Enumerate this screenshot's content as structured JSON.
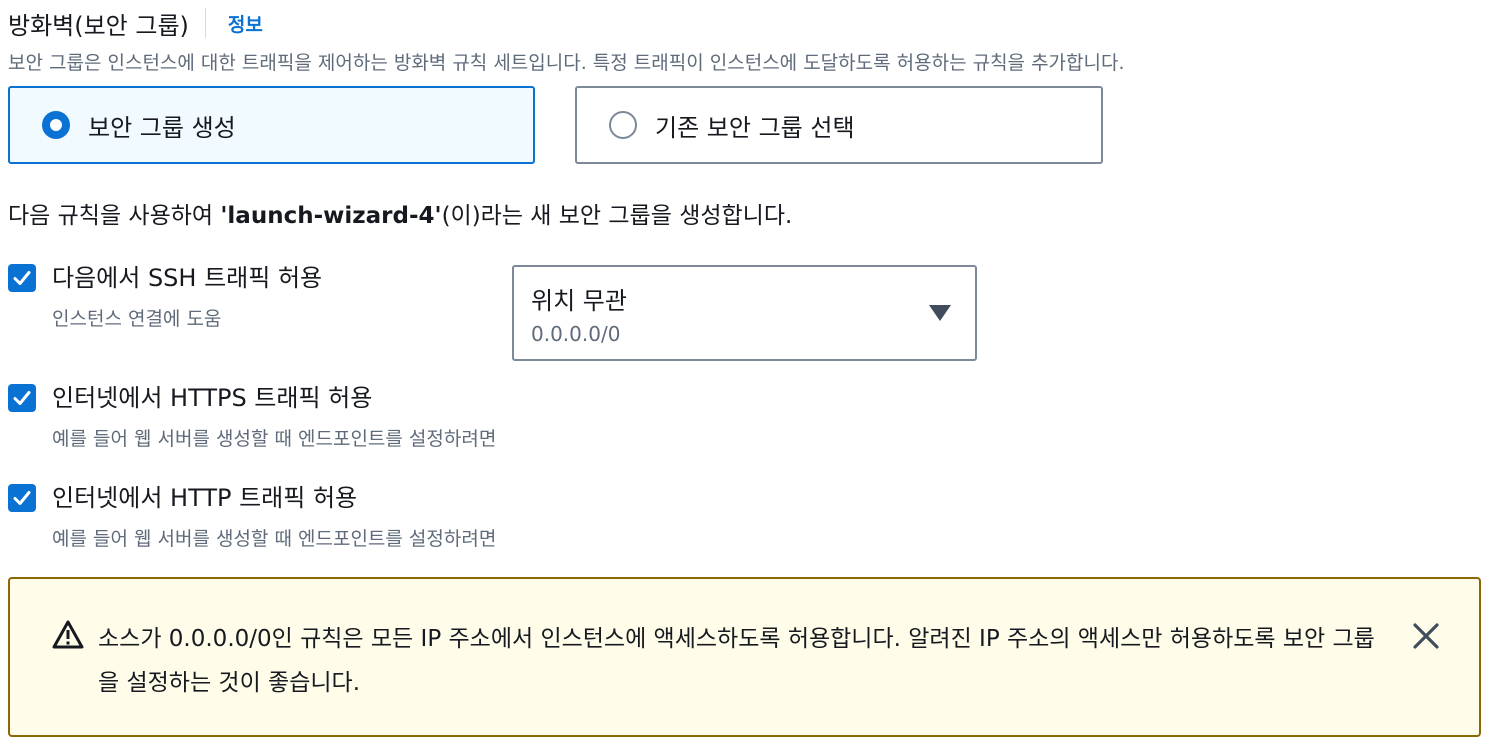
{
  "header": {
    "title": "방화벽(보안 그룹)",
    "info_link": "정보"
  },
  "description": "보안 그룹은 인스턴스에 대한 트래픽을 제어하는 방화벽 규칙 세트입니다. 특정 트래픽이 인스턴스에 도달하도록 허용하는 규칙을 추가합니다.",
  "security_group_options": [
    {
      "label": "보안 그룹 생성",
      "selected": true
    },
    {
      "label": "기존 보안 그룹 선택",
      "selected": false
    }
  ],
  "summary": {
    "prefix": "다음 규칙을 사용하여 ",
    "name": "'launch-wizard-4'",
    "suffix": "(이)라는 새 보안 그룹을 생성합니다."
  },
  "rules": [
    {
      "label": "다음에서 SSH 트래픽 허용",
      "sublabel": "인스턴스 연결에 도움",
      "checked": true
    },
    {
      "label": "인터넷에서 HTTPS 트래픽 허용",
      "sublabel": "예를 들어 웹 서버를 생성할 때 엔드포인트를 설정하려면",
      "checked": true
    },
    {
      "label": "인터넷에서 HTTP 트래픽 허용",
      "sublabel": "예를 들어 웹 서버를 생성할 때 엔드포인트를 설정하려면",
      "checked": true
    }
  ],
  "ssh_source_select": {
    "value": "위치 무관",
    "description": "0.0.0.0/0"
  },
  "alert": {
    "type": "warning",
    "icon": "warning-icon",
    "text": "소스가 0.0.0.0/0인 규칙은 모든 IP 주소에서 인스턴스에 액세스하도록 허용합니다. 알려진 IP 주소의 액세스만 허용하도록 보안 그룹을 설정하는 것이 좋습니다."
  },
  "colors": {
    "accent": "#0972d3",
    "warning_border": "#8d6605",
    "warning_bg": "#fffce9"
  }
}
